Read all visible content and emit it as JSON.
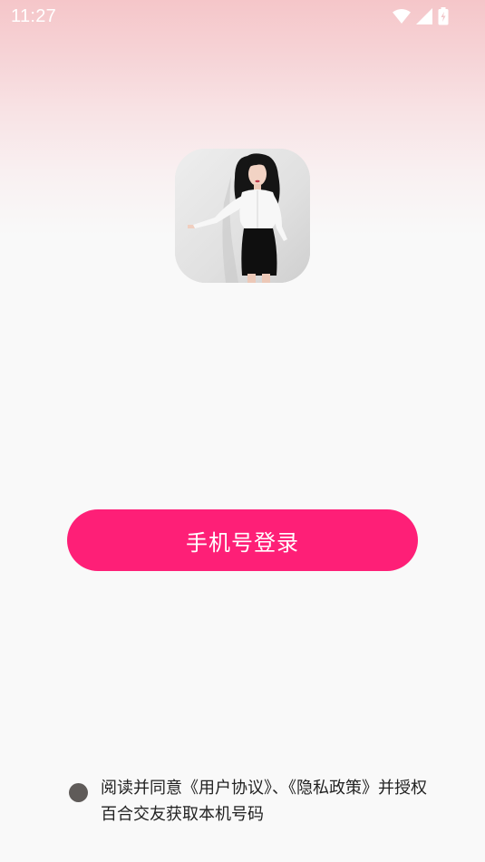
{
  "status_bar": {
    "time": "11:27",
    "icons": [
      "wifi-icon",
      "signal-icon",
      "battery-icon"
    ]
  },
  "app": {
    "avatar": "app-avatar-photo"
  },
  "login": {
    "phone_login_label": "手机号登录"
  },
  "agreement": {
    "checked": false,
    "prefix": "阅读并同意",
    "user_agreement": "《用户协议》",
    "separator": "、",
    "privacy_policy": "《隐私政策》",
    "suffix": "并授权百合交友获取本机号码"
  },
  "colors": {
    "accent": "#fe1f77",
    "background": "#f9f9f9",
    "header_gradient_top": "#f5c6c9",
    "checkbox": "#5f5b59"
  }
}
